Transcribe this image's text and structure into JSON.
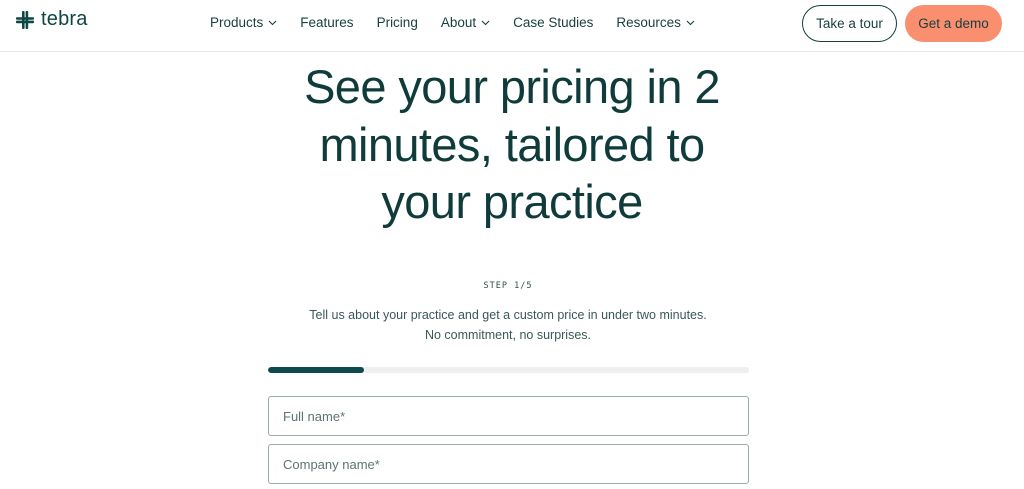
{
  "brand": {
    "name": "tebra",
    "color": "#0f4544"
  },
  "nav": {
    "items": [
      {
        "label": "Products",
        "dropdown": true
      },
      {
        "label": "Features",
        "dropdown": false
      },
      {
        "label": "Pricing",
        "dropdown": false
      },
      {
        "label": "About",
        "dropdown": true
      },
      {
        "label": "Case Studies",
        "dropdown": false
      },
      {
        "label": "Resources",
        "dropdown": true
      }
    ],
    "tour_label": "Take a tour",
    "demo_label": "Get a demo"
  },
  "hero": {
    "title_lines": [
      "See your pricing in 2",
      "minutes, tailored to",
      "your practice"
    ]
  },
  "form": {
    "step_label": "STEP 1/5",
    "progress": 0.2,
    "intro_line1": "Tell us about your practice and get a custom price in under two minutes.",
    "intro_line2": "No commitment, no surprises.",
    "full_name_placeholder": "Full name*",
    "company_name_placeholder": "Company name*"
  },
  "colors": {
    "primary": "#0f3b3a",
    "accent": "#fa8f70",
    "progress_fill": "#0e4a4b",
    "progress_track": "#edf0ef"
  }
}
